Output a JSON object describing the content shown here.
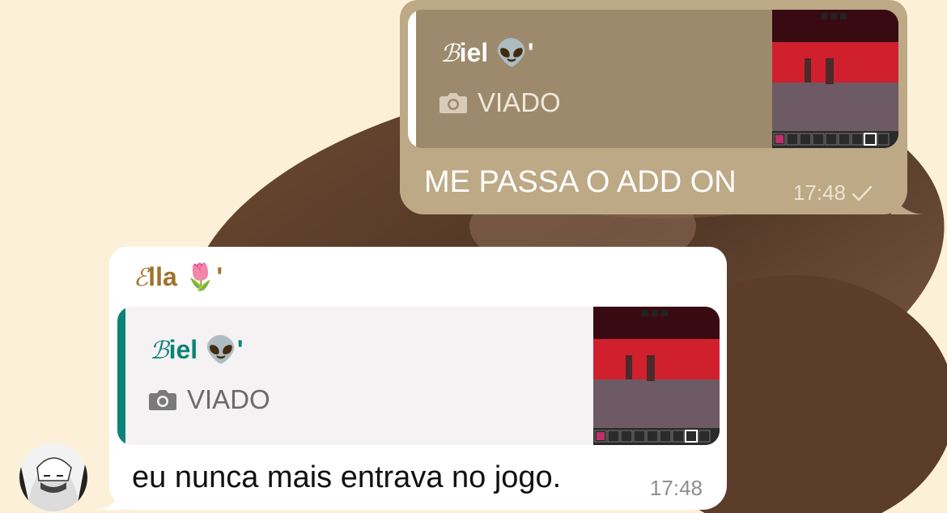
{
  "colors": {
    "wallpaper": "#fcf1d8",
    "outgoing_bubble": "#bda985",
    "incoming_bubble": "#ffffff",
    "sender_name": "#a0722b",
    "quoted_author_incoming": "#0c8475"
  },
  "outgoing": {
    "quote": {
      "author_initial": "ℬ",
      "author_rest": "iel 👽'",
      "media_icon": "camera-icon",
      "caption": "VIADO"
    },
    "text": "ME PASSA O ADD ON",
    "time": "17:48",
    "status_icon": "single-check-icon"
  },
  "incoming": {
    "sender_initial": "ℰ",
    "sender_rest": "lla 🌷'",
    "quote": {
      "author_initial": "ℬ",
      "author_rest": "iel 👽'",
      "media_icon": "camera-icon",
      "caption": "VIADO"
    },
    "text": "eu nunca mais entrava no jogo.",
    "time": "17:48"
  }
}
